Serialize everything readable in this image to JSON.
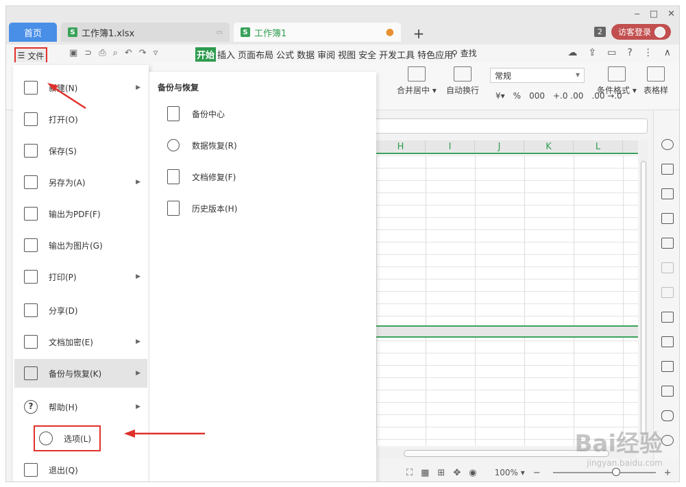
{
  "titlebar": {
    "tabs": [
      {
        "label": "首页"
      },
      {
        "label": "工作簿1.xlsx"
      },
      {
        "label": "工作簿1"
      }
    ],
    "sheet_icon": "S",
    "new_tab": "+",
    "window_count": "2",
    "login_label": "访客登录",
    "window_controls": [
      "‒",
      "□",
      "✕"
    ]
  },
  "menubar": {
    "file_label": "文件",
    "tabs": [
      "开始",
      "插入",
      "页面布局",
      "公式",
      "数据",
      "审阅",
      "视图",
      "安全",
      "开发工具",
      "特色应用"
    ],
    "active_tab": "开始",
    "search_label": "查找",
    "help": "?"
  },
  "ribbon": {
    "merge_center": "合并居中",
    "wrap_text": "自动换行",
    "number_format": "常规",
    "cond_format": "条件格式",
    "table_style": "表格样",
    "percent": "%",
    "num1": "000",
    "num2": "+.0 .00",
    "num3": ".00 →.0"
  },
  "sheet": {
    "columns": [
      "H",
      "I",
      "J",
      "K",
      "L"
    ]
  },
  "status": {
    "zoom": "100%",
    "zoom_plus": "+"
  },
  "file_menu": {
    "items": [
      {
        "label": "新建(N)",
        "has_sub": true
      },
      {
        "label": "打开(O)",
        "has_sub": false
      },
      {
        "label": "保存(S)",
        "has_sub": false
      },
      {
        "label": "另存为(A)",
        "has_sub": true
      },
      {
        "label": "输出为PDF(F)",
        "has_sub": false
      },
      {
        "label": "输出为图片(G)",
        "has_sub": false
      },
      {
        "label": "打印(P)",
        "has_sub": true
      },
      {
        "label": "分享(D)",
        "has_sub": false
      },
      {
        "label": "文档加密(E)",
        "has_sub": true
      },
      {
        "label": "备份与恢复(K)",
        "has_sub": true
      },
      {
        "label": "帮助(H)",
        "has_sub": true
      },
      {
        "label": "选项(L)",
        "has_sub": false
      },
      {
        "label": "退出(Q)",
        "has_sub": false
      }
    ],
    "help_glyph": "?"
  },
  "submenu": {
    "title": "备份与恢复",
    "items": [
      {
        "label": "备份中心"
      },
      {
        "label": "数据恢复(R)"
      },
      {
        "label": "文档修复(F)"
      },
      {
        "label": "历史版本(H)"
      }
    ]
  },
  "watermark": {
    "brand": "Bai经验",
    "url": "jingyan.baidu.com"
  },
  "colors": {
    "accent_green": "#2e9b4f",
    "home_tab_blue": "#4a8fe7",
    "highlight_red": "#e0302a",
    "login_red": "#c24f4f"
  }
}
